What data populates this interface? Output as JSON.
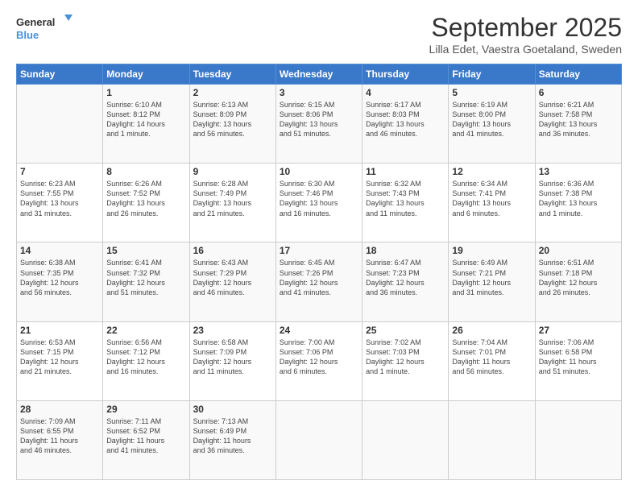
{
  "header": {
    "logo_line1": "General",
    "logo_line2": "Blue",
    "month": "September 2025",
    "location": "Lilla Edet, Vaestra Goetaland, Sweden"
  },
  "days_of_week": [
    "Sunday",
    "Monday",
    "Tuesday",
    "Wednesday",
    "Thursday",
    "Friday",
    "Saturday"
  ],
  "weeks": [
    [
      {
        "day": "",
        "info": ""
      },
      {
        "day": "1",
        "info": "Sunrise: 6:10 AM\nSunset: 8:12 PM\nDaylight: 14 hours\nand 1 minute."
      },
      {
        "day": "2",
        "info": "Sunrise: 6:13 AM\nSunset: 8:09 PM\nDaylight: 13 hours\nand 56 minutes."
      },
      {
        "day": "3",
        "info": "Sunrise: 6:15 AM\nSunset: 8:06 PM\nDaylight: 13 hours\nand 51 minutes."
      },
      {
        "day": "4",
        "info": "Sunrise: 6:17 AM\nSunset: 8:03 PM\nDaylight: 13 hours\nand 46 minutes."
      },
      {
        "day": "5",
        "info": "Sunrise: 6:19 AM\nSunset: 8:00 PM\nDaylight: 13 hours\nand 41 minutes."
      },
      {
        "day": "6",
        "info": "Sunrise: 6:21 AM\nSunset: 7:58 PM\nDaylight: 13 hours\nand 36 minutes."
      }
    ],
    [
      {
        "day": "7",
        "info": "Sunrise: 6:23 AM\nSunset: 7:55 PM\nDaylight: 13 hours\nand 31 minutes."
      },
      {
        "day": "8",
        "info": "Sunrise: 6:26 AM\nSunset: 7:52 PM\nDaylight: 13 hours\nand 26 minutes."
      },
      {
        "day": "9",
        "info": "Sunrise: 6:28 AM\nSunset: 7:49 PM\nDaylight: 13 hours\nand 21 minutes."
      },
      {
        "day": "10",
        "info": "Sunrise: 6:30 AM\nSunset: 7:46 PM\nDaylight: 13 hours\nand 16 minutes."
      },
      {
        "day": "11",
        "info": "Sunrise: 6:32 AM\nSunset: 7:43 PM\nDaylight: 13 hours\nand 11 minutes."
      },
      {
        "day": "12",
        "info": "Sunrise: 6:34 AM\nSunset: 7:41 PM\nDaylight: 13 hours\nand 6 minutes."
      },
      {
        "day": "13",
        "info": "Sunrise: 6:36 AM\nSunset: 7:38 PM\nDaylight: 13 hours\nand 1 minute."
      }
    ],
    [
      {
        "day": "14",
        "info": "Sunrise: 6:38 AM\nSunset: 7:35 PM\nDaylight: 12 hours\nand 56 minutes."
      },
      {
        "day": "15",
        "info": "Sunrise: 6:41 AM\nSunset: 7:32 PM\nDaylight: 12 hours\nand 51 minutes."
      },
      {
        "day": "16",
        "info": "Sunrise: 6:43 AM\nSunset: 7:29 PM\nDaylight: 12 hours\nand 46 minutes."
      },
      {
        "day": "17",
        "info": "Sunrise: 6:45 AM\nSunset: 7:26 PM\nDaylight: 12 hours\nand 41 minutes."
      },
      {
        "day": "18",
        "info": "Sunrise: 6:47 AM\nSunset: 7:23 PM\nDaylight: 12 hours\nand 36 minutes."
      },
      {
        "day": "19",
        "info": "Sunrise: 6:49 AM\nSunset: 7:21 PM\nDaylight: 12 hours\nand 31 minutes."
      },
      {
        "day": "20",
        "info": "Sunrise: 6:51 AM\nSunset: 7:18 PM\nDaylight: 12 hours\nand 26 minutes."
      }
    ],
    [
      {
        "day": "21",
        "info": "Sunrise: 6:53 AM\nSunset: 7:15 PM\nDaylight: 12 hours\nand 21 minutes."
      },
      {
        "day": "22",
        "info": "Sunrise: 6:56 AM\nSunset: 7:12 PM\nDaylight: 12 hours\nand 16 minutes."
      },
      {
        "day": "23",
        "info": "Sunrise: 6:58 AM\nSunset: 7:09 PM\nDaylight: 12 hours\nand 11 minutes."
      },
      {
        "day": "24",
        "info": "Sunrise: 7:00 AM\nSunset: 7:06 PM\nDaylight: 12 hours\nand 6 minutes."
      },
      {
        "day": "25",
        "info": "Sunrise: 7:02 AM\nSunset: 7:03 PM\nDaylight: 12 hours\nand 1 minute."
      },
      {
        "day": "26",
        "info": "Sunrise: 7:04 AM\nSunset: 7:01 PM\nDaylight: 11 hours\nand 56 minutes."
      },
      {
        "day": "27",
        "info": "Sunrise: 7:06 AM\nSunset: 6:58 PM\nDaylight: 11 hours\nand 51 minutes."
      }
    ],
    [
      {
        "day": "28",
        "info": "Sunrise: 7:09 AM\nSunset: 6:55 PM\nDaylight: 11 hours\nand 46 minutes."
      },
      {
        "day": "29",
        "info": "Sunrise: 7:11 AM\nSunset: 6:52 PM\nDaylight: 11 hours\nand 41 minutes."
      },
      {
        "day": "30",
        "info": "Sunrise: 7:13 AM\nSunset: 6:49 PM\nDaylight: 11 hours\nand 36 minutes."
      },
      {
        "day": "",
        "info": ""
      },
      {
        "day": "",
        "info": ""
      },
      {
        "day": "",
        "info": ""
      },
      {
        "day": "",
        "info": ""
      }
    ]
  ]
}
